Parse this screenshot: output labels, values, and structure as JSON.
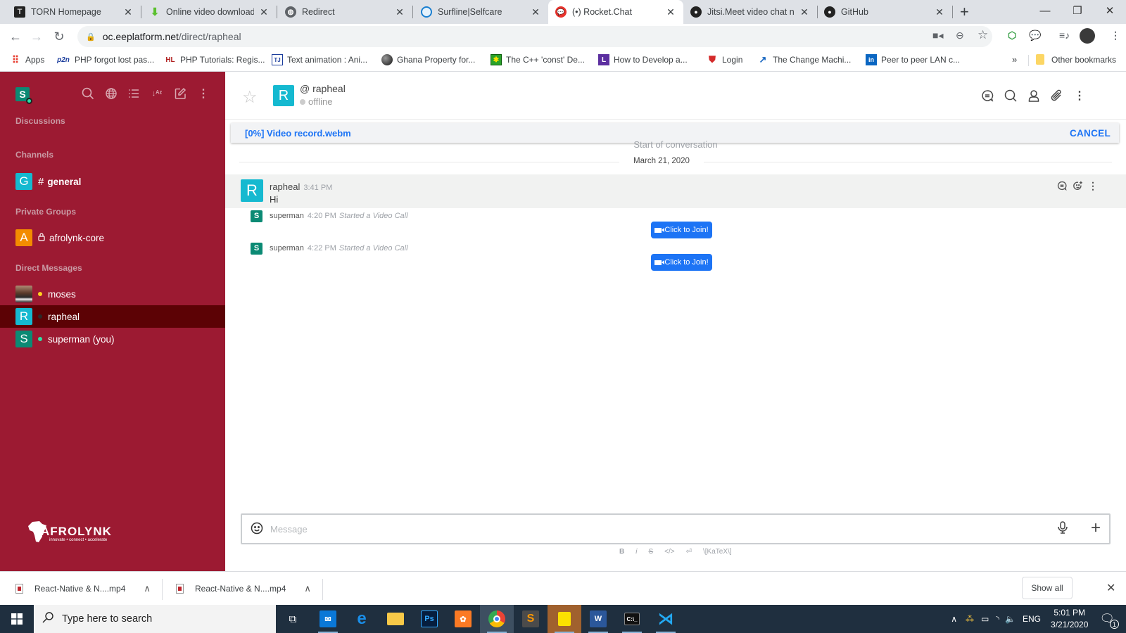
{
  "browser": {
    "tabs": [
      {
        "title": "TORN Homepage",
        "icon": "torn-icon",
        "active": false
      },
      {
        "title": "Online video downloader",
        "icon": "download-arrow-icon",
        "active": false
      },
      {
        "title": "Redirect",
        "icon": "globe-icon",
        "active": false
      },
      {
        "title": "Surfline|Selfcare",
        "icon": "surfline-icon",
        "active": false
      },
      {
        "title": "(•) Rocket.Chat",
        "icon": "rocketchat-icon",
        "active": true
      },
      {
        "title": "Jitsi.Meet video chat not",
        "icon": "github-icon",
        "active": false
      },
      {
        "title": "GitHub",
        "icon": "github-icon",
        "active": false
      }
    ],
    "new_tab": "+",
    "url": {
      "host": "oc.eeplatform.net",
      "path": "/direct/rapheal"
    },
    "bookmarks": [
      {
        "label": "Apps",
        "icon": "apps-grid-icon"
      },
      {
        "label": "PHP forgot lost pas...",
        "icon": "p2n-icon"
      },
      {
        "label": "PHP Tutorials: Regis...",
        "icon": "hl-icon"
      },
      {
        "label": "Text animation : Ani...",
        "icon": "tjs-icon"
      },
      {
        "label": "Ghana Property for...",
        "icon": "ball-icon"
      },
      {
        "label": "The C++ 'const' De...",
        "icon": "cpp-icon"
      },
      {
        "label": "How to Develop a...",
        "icon": "purple-l-icon"
      },
      {
        "label": "Login",
        "icon": "shield-icon"
      },
      {
        "label": "The Change Machi...",
        "icon": "change-icon"
      },
      {
        "label": "Peer to peer LAN c...",
        "icon": "linkedin-icon"
      }
    ],
    "bookmarks_overflow": "»",
    "other_bookmarks": "Other bookmarks"
  },
  "sidebar": {
    "user_initial": "S",
    "user_status_color": "#2de0a5",
    "sections": {
      "discussions": "Discussions",
      "channels": "Channels",
      "private_groups": "Private Groups",
      "direct_messages": "Direct Messages"
    },
    "channels": [
      {
        "initial": "G",
        "prefix": "#",
        "name": "general",
        "color": "#15b9d0"
      }
    ],
    "private_groups": [
      {
        "initial": "A",
        "prefix": "lock",
        "name": "afrolynk-core",
        "color": "#f38c00"
      }
    ],
    "direct_messages": [
      {
        "initial": "",
        "name": "moses",
        "status_color": "#ffd21f",
        "avatar_type": "photo",
        "active": false
      },
      {
        "initial": "R",
        "name": "rapheal",
        "status_color": "#2a2a2a",
        "color": "#15b9d0",
        "active": true
      },
      {
        "initial": "S",
        "name": "superman (you)",
        "status_color": "#2de0a5",
        "color": "#0b8a74",
        "active": false
      }
    ],
    "logo": {
      "name": "AFROLYNK",
      "tagline": "innovate • connect • accelerate"
    }
  },
  "room": {
    "initial": "R",
    "name": "rapheal",
    "status": "offline",
    "upload": {
      "progress_label": "[0%] Video record.webm",
      "progress_percent": 0,
      "cancel_label": "CANCEL"
    },
    "start_label": "Start of conversation",
    "date_label": "March 21, 2020",
    "messages": [
      {
        "user": "rapheal",
        "initial": "R",
        "time": "3:41 PM",
        "text": "Hi"
      }
    ],
    "system_messages": [
      {
        "user": "superman",
        "initial": "S",
        "time": "4:20 PM",
        "action": "Started a Video Call",
        "button": "Click to Join!"
      },
      {
        "user": "superman",
        "initial": "S",
        "time": "4:22 PM",
        "action": "Started a Video Call",
        "button": "Click to Join!"
      }
    ],
    "composer": {
      "placeholder": "Message",
      "format_items": [
        "B",
        "i",
        "S",
        "</>",
        "⏎",
        "\\[KaTeX\\]"
      ]
    }
  },
  "downloads": {
    "items": [
      {
        "name": "React-Native & N....mp4"
      },
      {
        "name": "React-Native & N....mp4"
      }
    ],
    "show_all": "Show all"
  },
  "taskbar": {
    "search_placeholder": "Type here to search",
    "tray": {
      "language": "ENG",
      "time": "5:01 PM",
      "date": "3/21/2020",
      "notifications": "1"
    }
  }
}
